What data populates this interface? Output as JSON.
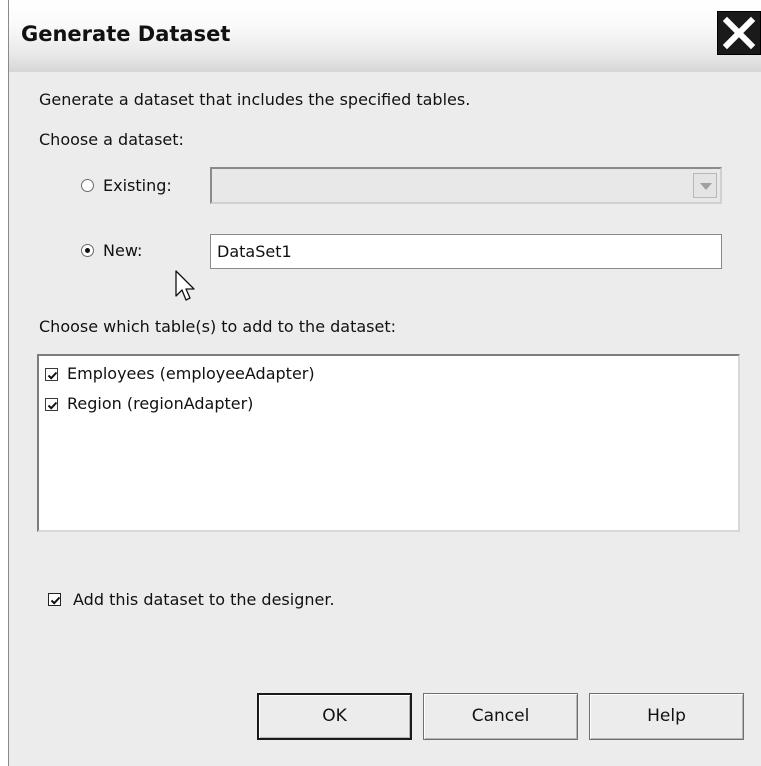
{
  "window": {
    "title": "Generate Dataset"
  },
  "intro_text": "Generate a dataset that includes the specified tables.",
  "choose_dataset_label": "Choose a dataset:",
  "existing": {
    "label": "Existing:",
    "selected": false,
    "dropdown_value": "",
    "enabled": false
  },
  "new": {
    "label": "New:",
    "selected": true,
    "value": "DataSet1"
  },
  "tables_label": "Choose which table(s) to add to the dataset:",
  "tables": [
    {
      "label": "Employees (employeeAdapter)",
      "checked": true
    },
    {
      "label": "Region (regionAdapter)",
      "checked": true
    }
  ],
  "add_to_designer": {
    "label": "Add this dataset to the designer.",
    "checked": true
  },
  "buttons": {
    "ok": "OK",
    "cancel": "Cancel",
    "help": "Help"
  },
  "icons": {
    "close": "close-icon",
    "dropdown": "chevron-down-icon",
    "cursor": "mouse-pointer-icon"
  }
}
